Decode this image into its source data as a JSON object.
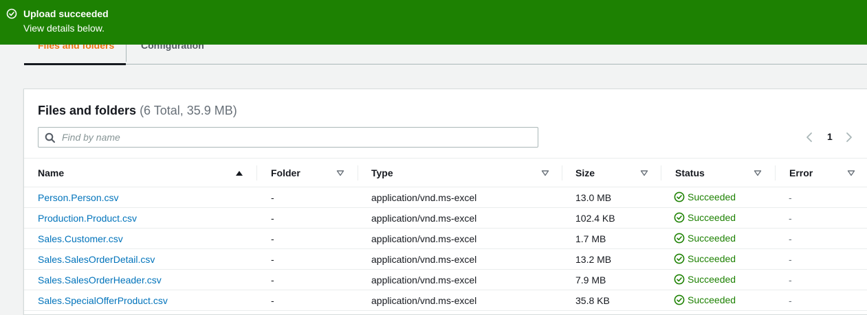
{
  "banner": {
    "title": "Upload succeeded",
    "subtitle": "View details below.",
    "color": "#1d8102"
  },
  "tabs": [
    {
      "label": "Files and folders"
    },
    {
      "label": "Configuration"
    }
  ],
  "panel": {
    "title": "Files and folders",
    "count": "(6 Total, 35.9 MB)",
    "search_placeholder": "Find by name",
    "search_value": "",
    "page": "1"
  },
  "columns": [
    {
      "label": "Name",
      "sort": "ascending"
    },
    {
      "label": "Folder"
    },
    {
      "label": "Type"
    },
    {
      "label": "Size"
    },
    {
      "label": "Status"
    },
    {
      "label": "Error"
    }
  ],
  "rows": [
    {
      "name": "Person.Person.csv",
      "folder": "-",
      "type": "application/vnd.ms-excel",
      "size": "13.0 MB",
      "status": "Succeeded",
      "error": "-"
    },
    {
      "name": "Production.Product.csv",
      "folder": "-",
      "type": "application/vnd.ms-excel",
      "size": "102.4 KB",
      "status": "Succeeded",
      "error": "-"
    },
    {
      "name": "Sales.Customer.csv",
      "folder": "-",
      "type": "application/vnd.ms-excel",
      "size": "1.7 MB",
      "status": "Succeeded",
      "error": "-"
    },
    {
      "name": "Sales.SalesOrderDetail.csv",
      "folder": "-",
      "type": "application/vnd.ms-excel",
      "size": "13.2 MB",
      "status": "Succeeded",
      "error": "-"
    },
    {
      "name": "Sales.SalesOrderHeader.csv",
      "folder": "-",
      "type": "application/vnd.ms-excel",
      "size": "7.9 MB",
      "status": "Succeeded",
      "error": "-"
    },
    {
      "name": "Sales.SpecialOfferProduct.csv",
      "folder": "-",
      "type": "application/vnd.ms-excel",
      "size": "35.8 KB",
      "status": "Succeeded",
      "error": "-"
    }
  ],
  "icons": {
    "banner": "check-circle-icon",
    "search": "search-icon",
    "status": "check-circle-icon",
    "prev": "chevron-left-icon",
    "next": "chevron-right-icon",
    "sort_asc": "caret-up-icon",
    "sort_filter": "caret-down-icon"
  }
}
